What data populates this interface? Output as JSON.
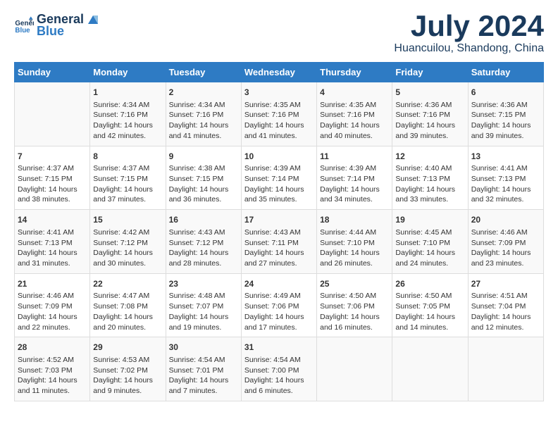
{
  "header": {
    "logo_line1": "General",
    "logo_line2": "Blue",
    "month": "July 2024",
    "location": "Huancuilou, Shandong, China"
  },
  "days_of_week": [
    "Sunday",
    "Monday",
    "Tuesday",
    "Wednesday",
    "Thursday",
    "Friday",
    "Saturday"
  ],
  "weeks": [
    [
      {
        "day": "",
        "text": ""
      },
      {
        "day": "1",
        "text": "Sunrise: 4:34 AM\nSunset: 7:16 PM\nDaylight: 14 hours\nand 42 minutes."
      },
      {
        "day": "2",
        "text": "Sunrise: 4:34 AM\nSunset: 7:16 PM\nDaylight: 14 hours\nand 41 minutes."
      },
      {
        "day": "3",
        "text": "Sunrise: 4:35 AM\nSunset: 7:16 PM\nDaylight: 14 hours\nand 41 minutes."
      },
      {
        "day": "4",
        "text": "Sunrise: 4:35 AM\nSunset: 7:16 PM\nDaylight: 14 hours\nand 40 minutes."
      },
      {
        "day": "5",
        "text": "Sunrise: 4:36 AM\nSunset: 7:16 PM\nDaylight: 14 hours\nand 39 minutes."
      },
      {
        "day": "6",
        "text": "Sunrise: 4:36 AM\nSunset: 7:15 PM\nDaylight: 14 hours\nand 39 minutes."
      }
    ],
    [
      {
        "day": "7",
        "text": "Sunrise: 4:37 AM\nSunset: 7:15 PM\nDaylight: 14 hours\nand 38 minutes."
      },
      {
        "day": "8",
        "text": "Sunrise: 4:37 AM\nSunset: 7:15 PM\nDaylight: 14 hours\nand 37 minutes."
      },
      {
        "day": "9",
        "text": "Sunrise: 4:38 AM\nSunset: 7:15 PM\nDaylight: 14 hours\nand 36 minutes."
      },
      {
        "day": "10",
        "text": "Sunrise: 4:39 AM\nSunset: 7:14 PM\nDaylight: 14 hours\nand 35 minutes."
      },
      {
        "day": "11",
        "text": "Sunrise: 4:39 AM\nSunset: 7:14 PM\nDaylight: 14 hours\nand 34 minutes."
      },
      {
        "day": "12",
        "text": "Sunrise: 4:40 AM\nSunset: 7:13 PM\nDaylight: 14 hours\nand 33 minutes."
      },
      {
        "day": "13",
        "text": "Sunrise: 4:41 AM\nSunset: 7:13 PM\nDaylight: 14 hours\nand 32 minutes."
      }
    ],
    [
      {
        "day": "14",
        "text": "Sunrise: 4:41 AM\nSunset: 7:13 PM\nDaylight: 14 hours\nand 31 minutes."
      },
      {
        "day": "15",
        "text": "Sunrise: 4:42 AM\nSunset: 7:12 PM\nDaylight: 14 hours\nand 30 minutes."
      },
      {
        "day": "16",
        "text": "Sunrise: 4:43 AM\nSunset: 7:12 PM\nDaylight: 14 hours\nand 28 minutes."
      },
      {
        "day": "17",
        "text": "Sunrise: 4:43 AM\nSunset: 7:11 PM\nDaylight: 14 hours\nand 27 minutes."
      },
      {
        "day": "18",
        "text": "Sunrise: 4:44 AM\nSunset: 7:10 PM\nDaylight: 14 hours\nand 26 minutes."
      },
      {
        "day": "19",
        "text": "Sunrise: 4:45 AM\nSunset: 7:10 PM\nDaylight: 14 hours\nand 24 minutes."
      },
      {
        "day": "20",
        "text": "Sunrise: 4:46 AM\nSunset: 7:09 PM\nDaylight: 14 hours\nand 23 minutes."
      }
    ],
    [
      {
        "day": "21",
        "text": "Sunrise: 4:46 AM\nSunset: 7:09 PM\nDaylight: 14 hours\nand 22 minutes."
      },
      {
        "day": "22",
        "text": "Sunrise: 4:47 AM\nSunset: 7:08 PM\nDaylight: 14 hours\nand 20 minutes."
      },
      {
        "day": "23",
        "text": "Sunrise: 4:48 AM\nSunset: 7:07 PM\nDaylight: 14 hours\nand 19 minutes."
      },
      {
        "day": "24",
        "text": "Sunrise: 4:49 AM\nSunset: 7:06 PM\nDaylight: 14 hours\nand 17 minutes."
      },
      {
        "day": "25",
        "text": "Sunrise: 4:50 AM\nSunset: 7:06 PM\nDaylight: 14 hours\nand 16 minutes."
      },
      {
        "day": "26",
        "text": "Sunrise: 4:50 AM\nSunset: 7:05 PM\nDaylight: 14 hours\nand 14 minutes."
      },
      {
        "day": "27",
        "text": "Sunrise: 4:51 AM\nSunset: 7:04 PM\nDaylight: 14 hours\nand 12 minutes."
      }
    ],
    [
      {
        "day": "28",
        "text": "Sunrise: 4:52 AM\nSunset: 7:03 PM\nDaylight: 14 hours\nand 11 minutes."
      },
      {
        "day": "29",
        "text": "Sunrise: 4:53 AM\nSunset: 7:02 PM\nDaylight: 14 hours\nand 9 minutes."
      },
      {
        "day": "30",
        "text": "Sunrise: 4:54 AM\nSunset: 7:01 PM\nDaylight: 14 hours\nand 7 minutes."
      },
      {
        "day": "31",
        "text": "Sunrise: 4:54 AM\nSunset: 7:00 PM\nDaylight: 14 hours\nand 6 minutes."
      },
      {
        "day": "",
        "text": ""
      },
      {
        "day": "",
        "text": ""
      },
      {
        "day": "",
        "text": ""
      }
    ]
  ]
}
